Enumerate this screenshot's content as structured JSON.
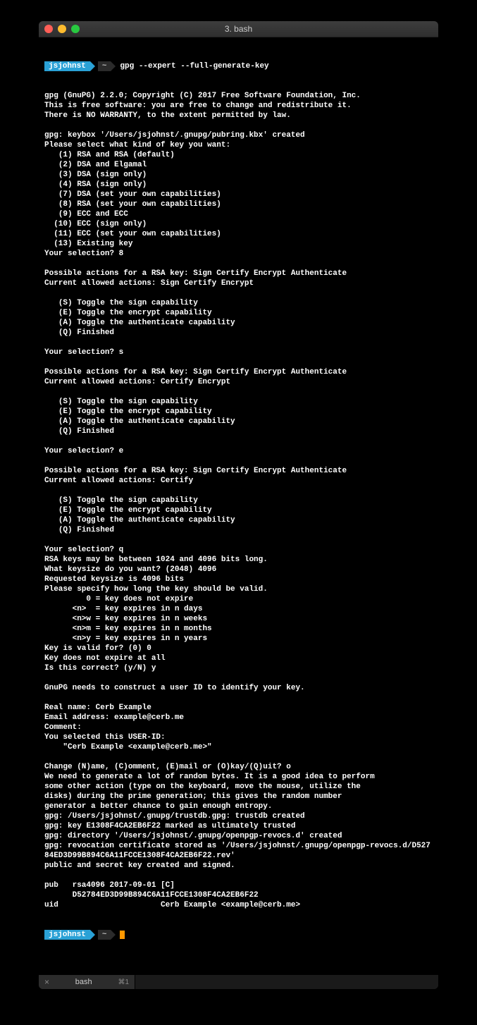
{
  "window": {
    "title": "3. bash"
  },
  "prompt": {
    "user": "jsjohnst",
    "sep": "~",
    "command": "gpg --expert --full-generate-key"
  },
  "output": {
    "lines": [
      "gpg (GnuPG) 2.2.0; Copyright (C) 2017 Free Software Foundation, Inc.",
      "This is free software: you are free to change and redistribute it.",
      "There is NO WARRANTY, to the extent permitted by law.",
      "",
      "gpg: keybox '/Users/jsjohnst/.gnupg/pubring.kbx' created",
      "Please select what kind of key you want:",
      "   (1) RSA and RSA (default)",
      "   (2) DSA and Elgamal",
      "   (3) DSA (sign only)",
      "   (4) RSA (sign only)",
      "   (7) DSA (set your own capabilities)",
      "   (8) RSA (set your own capabilities)",
      "   (9) ECC and ECC",
      "  (10) ECC (sign only)",
      "  (11) ECC (set your own capabilities)",
      "  (13) Existing key",
      "Your selection? 8",
      "",
      "Possible actions for a RSA key: Sign Certify Encrypt Authenticate",
      "Current allowed actions: Sign Certify Encrypt",
      "",
      "   (S) Toggle the sign capability",
      "   (E) Toggle the encrypt capability",
      "   (A) Toggle the authenticate capability",
      "   (Q) Finished",
      "",
      "Your selection? s",
      "",
      "Possible actions for a RSA key: Sign Certify Encrypt Authenticate",
      "Current allowed actions: Certify Encrypt",
      "",
      "   (S) Toggle the sign capability",
      "   (E) Toggle the encrypt capability",
      "   (A) Toggle the authenticate capability",
      "   (Q) Finished",
      "",
      "Your selection? e",
      "",
      "Possible actions for a RSA key: Sign Certify Encrypt Authenticate",
      "Current allowed actions: Certify",
      "",
      "   (S) Toggle the sign capability",
      "   (E) Toggle the encrypt capability",
      "   (A) Toggle the authenticate capability",
      "   (Q) Finished",
      "",
      "Your selection? q",
      "RSA keys may be between 1024 and 4096 bits long.",
      "What keysize do you want? (2048) 4096",
      "Requested keysize is 4096 bits",
      "Please specify how long the key should be valid.",
      "         0 = key does not expire",
      "      <n>  = key expires in n days",
      "      <n>w = key expires in n weeks",
      "      <n>m = key expires in n months",
      "      <n>y = key expires in n years",
      "Key is valid for? (0) 0",
      "Key does not expire at all",
      "Is this correct? (y/N) y",
      "",
      "GnuPG needs to construct a user ID to identify your key.",
      "",
      "Real name: Cerb Example",
      "Email address: example@cerb.me",
      "Comment:",
      "You selected this USER-ID:",
      "    \"Cerb Example <example@cerb.me>\"",
      "",
      "Change (N)ame, (C)omment, (E)mail or (O)kay/(Q)uit? o",
      "We need to generate a lot of random bytes. It is a good idea to perform",
      "some other action (type on the keyboard, move the mouse, utilize the",
      "disks) during the prime generation; this gives the random number",
      "generator a better chance to gain enough entropy.",
      "gpg: /Users/jsjohnst/.gnupg/trustdb.gpg: trustdb created",
      "gpg: key E1308F4CA2EB6F22 marked as ultimately trusted",
      "gpg: directory '/Users/jsjohnst/.gnupg/openpgp-revocs.d' created",
      "gpg: revocation certificate stored as '/Users/jsjohnst/.gnupg/openpgp-revocs.d/D52784ED3D99B894C6A11FCCE1308F4CA2EB6F22.rev'",
      "public and secret key created and signed.",
      "",
      "pub   rsa4096 2017-09-01 [C]",
      "      D52784ED3D99B894C6A11FCCE1308F4CA2EB6F22",
      "uid                      Cerb Example <example@cerb.me>",
      ""
    ]
  },
  "prompt2": {
    "user": "jsjohnst",
    "sep": "~"
  },
  "tab": {
    "close": "×",
    "label": "bash",
    "shortcut": "⌘1"
  }
}
